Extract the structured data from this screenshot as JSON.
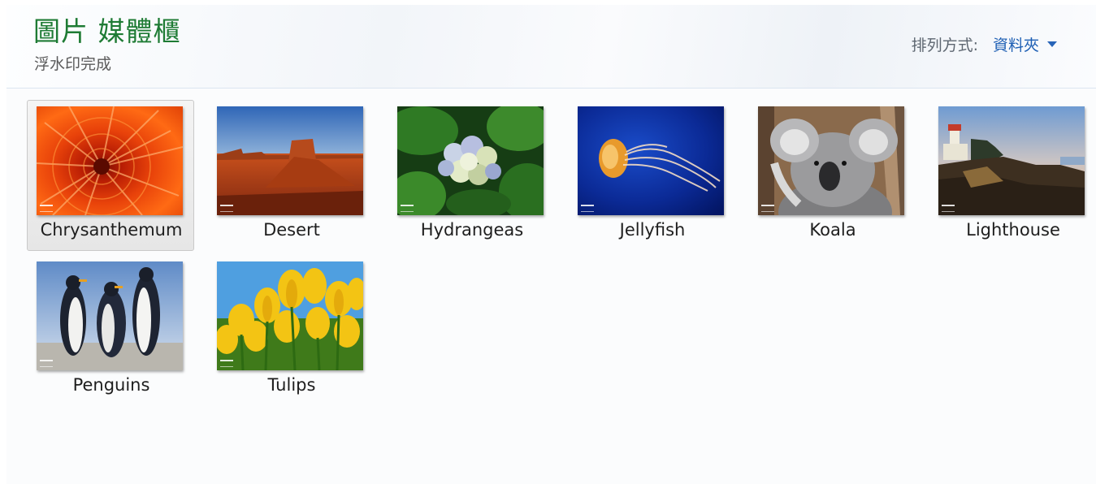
{
  "header": {
    "title": "圖片 媒體櫃",
    "subtitle": "浮水印完成",
    "arrange_label": "排列方式:",
    "arrange_value": "資料夾"
  },
  "colors": {
    "title": "#1e7b34",
    "link": "#1e5fb4"
  },
  "items": [
    {
      "name": "Chrysanthemum",
      "selected": true
    },
    {
      "name": "Desert",
      "selected": false
    },
    {
      "name": "Hydrangeas",
      "selected": false
    },
    {
      "name": "Jellyfish",
      "selected": false
    },
    {
      "name": "Koala",
      "selected": false
    },
    {
      "name": "Lighthouse",
      "selected": false
    },
    {
      "name": "Penguins",
      "selected": false
    },
    {
      "name": "Tulips",
      "selected": false
    }
  ]
}
